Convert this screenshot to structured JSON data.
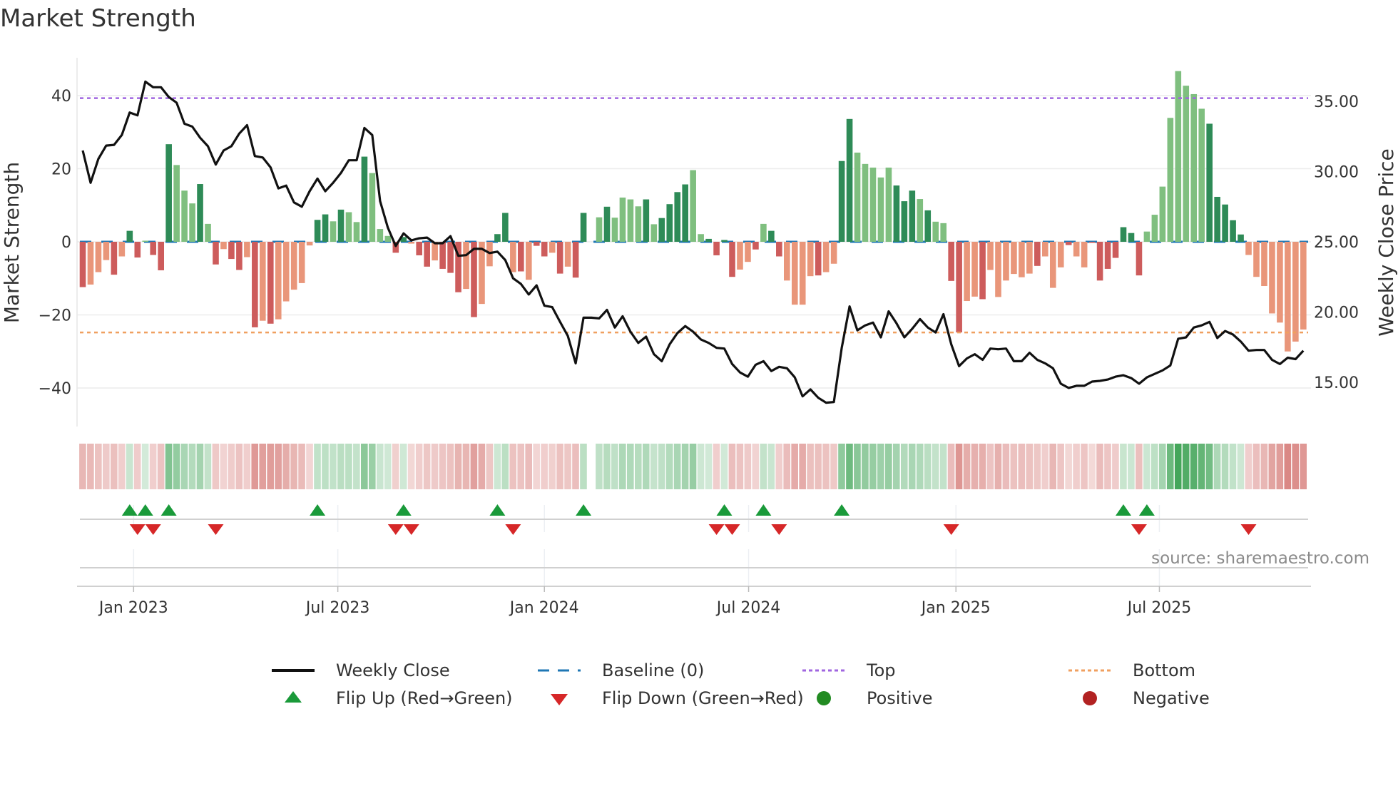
{
  "title": "Market Strength",
  "source": "source: sharemaestro.com",
  "colors": {
    "pos_strong": "#2e8b57",
    "pos_weak": "#7fbf7f",
    "neg_strong": "#cd5c5c",
    "neg_weak": "#e9967a",
    "close": "#111111",
    "baseline": "#1f77b4",
    "top": "#a066e0",
    "bottom": "#f0a060",
    "flip_up": "#1a9a3a",
    "flip_down": "#d62728",
    "positive": "#228b22",
    "negative": "#b22222"
  },
  "legend": [
    {
      "label": "Weekly Close",
      "icon": "solid-line"
    },
    {
      "label": "Baseline (0)",
      "icon": "dashed-line"
    },
    {
      "label": "Top",
      "icon": "dotted-line-purple"
    },
    {
      "label": "Bottom",
      "icon": "dotted-line-orange"
    },
    {
      "label": "Flip Up (Red→Green)",
      "icon": "triangle-up"
    },
    {
      "label": "Flip Down (Green→Red)",
      "icon": "triangle-down"
    },
    {
      "label": "Positive",
      "icon": "circle-green"
    },
    {
      "label": "Negative",
      "icon": "circle-red"
    }
  ],
  "chart_data": {
    "type": "bar",
    "title": "Market Strength",
    "ylabel": "Market Strength",
    "y2label": "Weekly Close Price",
    "ylim": [
      -52,
      50
    ],
    "y2lim": [
      12.4,
      37.4
    ],
    "yticks": [
      -40,
      -20,
      0,
      20,
      40
    ],
    "yticklabels": [
      "−40",
      "−20",
      "0",
      "20",
      "40"
    ],
    "y2ticks": [
      15,
      20,
      25,
      30,
      35
    ],
    "y2ticklabels": [
      "15.00",
      "20.00",
      "25.00",
      "30.00",
      "35.00"
    ],
    "xticks": [
      {
        "week": 6.5,
        "label": "Jan 2023"
      },
      {
        "week": 32.6,
        "label": "Jul 2023"
      },
      {
        "week": 59.0,
        "label": "Jan 2024"
      },
      {
        "week": 85.1,
        "label": "Jul 2024"
      },
      {
        "week": 111.6,
        "label": "Jan 2025"
      },
      {
        "week": 137.6,
        "label": "Jul 2025"
      }
    ],
    "top_level": 39.3,
    "bottom_level": -24.8,
    "baseline": 0,
    "grid": true,
    "legend_position": "bottom",
    "strength": [
      -12.4,
      -11.7,
      -8.3,
      -5,
      -9,
      -4,
      3,
      -4.3,
      0.3,
      -3.6,
      -7.8,
      26.7,
      21,
      14,
      10.5,
      15.8,
      4.9,
      -6.2,
      -2,
      -4.7,
      -7.7,
      -4.2,
      -23.4,
      -21.6,
      -22.4,
      -21.2,
      -16.3,
      -13.1,
      -11.3,
      -1,
      6,
      7.5,
      5.6,
      8.8,
      8.1,
      5.4,
      23.3,
      18.8,
      3.5,
      1.6,
      -3,
      1.3,
      -0.5,
      -3.7,
      -6.8,
      -5.1,
      -7.4,
      -8.5,
      -13.8,
      -12.9,
      -20.6,
      -17,
      -6.7,
      2.1,
      7.9,
      -8.3,
      -8.1,
      -10.4,
      -1.1,
      -4,
      -3,
      -8.7,
      -6.8,
      -9.8,
      7.9,
      0,
      6.7,
      9.6,
      6.6,
      12.1,
      11.6,
      9.7,
      11.6,
      4.8,
      6.5,
      10.3,
      13.6,
      15.7,
      19.6,
      2.1,
      0.8,
      -3.7,
      0.5,
      -9.6,
      -7.6,
      -5.5,
      -2.1,
      4.9,
      3,
      -4,
      -10.6,
      -17.2,
      -17.2,
      -9.4,
      -9.2,
      -8.3,
      -6,
      22.1,
      33.6,
      24.4,
      21.3,
      20.3,
      17.6,
      20.3,
      15.4,
      11.1,
      14,
      11.7,
      8.6,
      5.5,
      5.1,
      -10.7,
      -24.8,
      -16.2,
      -15,
      -15.7,
      -7.7,
      -15.1,
      -10.6,
      -8.8,
      -9.7,
      -8.7,
      -6.6,
      -4,
      -12.6,
      -7,
      -0.9,
      -4,
      -7,
      -0.3,
      -10.6,
      -7.4,
      -4.4,
      4,
      2.4,
      -9.2,
      2.8,
      7.4,
      15.1,
      33.9,
      46.7,
      42.7,
      40.4,
      36.4,
      32.3,
      12.3,
      10.2,
      5.9,
      2,
      -3.6,
      -9.6,
      -12.1,
      -19.6,
      -22.1,
      -30,
      -27.3,
      -24
    ],
    "strength_shade": "dllldlddlddd llldldld dldldlllll ddldlldlll ddlddldddl dllddldldd ldl d d-ldlllldl ddddllddd dlldlddlll ldllddlll lldddld llddlldlllllldlll dlldddddddlllllllldddddl l",
    "weekly_close": [
      31.5,
      29.2,
      30.9,
      31.85,
      31.9,
      32.6,
      34.2,
      34.0,
      36.4,
      36.0,
      36.0,
      35.3,
      34.9,
      33.4,
      33.2,
      32.4,
      31.8,
      30.5,
      31.5,
      31.8,
      32.7,
      33.3,
      31.1,
      31.0,
      30.3,
      28.8,
      29.0,
      27.8,
      27.5,
      28.6,
      29.5,
      28.6,
      29.2,
      29.9,
      30.8,
      30.8,
      33.1,
      32.6,
      27.9,
      26.0,
      24.7,
      25.6,
      25.1,
      25.25,
      25.3,
      24.9,
      24.9,
      25.4,
      24.0,
      24.05,
      24.5,
      24.5,
      24.2,
      24.3,
      23.7,
      22.4,
      22.0,
      21.25,
      21.9,
      20.45,
      20.35,
      19.3,
      18.3,
      16.35,
      19.6,
      19.6,
      19.55,
      20.15,
      18.9,
      19.7,
      18.6,
      17.8,
      18.25,
      17.0,
      16.5,
      17.7,
      18.5,
      19.0,
      18.6,
      18.05,
      17.8,
      17.45,
      17.4,
      16.3,
      15.7,
      15.4,
      16.25,
      16.5,
      15.8,
      16.1,
      16.0,
      15.35,
      14.0,
      14.5,
      13.9,
      13.55,
      13.6,
      17.45,
      20.4,
      18.7,
      19.05,
      19.25,
      18.2,
      20.05,
      19.2,
      18.2,
      18.8,
      19.5,
      18.9,
      18.55,
      19.85,
      17.7,
      16.15,
      16.7,
      17.0,
      16.6,
      17.4,
      17.35,
      17.4,
      16.5,
      16.5,
      17.1,
      16.6,
      16.35,
      16.0,
      14.9,
      14.6,
      14.75,
      14.75,
      15.05,
      15.1,
      15.2,
      15.4,
      15.5,
      15.3,
      14.9,
      15.35,
      15.6,
      15.85,
      16.2,
      18.1,
      18.2,
      18.9,
      19.05,
      19.3,
      18.15,
      18.65,
      18.4,
      17.9,
      17.25,
      17.3,
      17.3,
      16.6,
      16.3,
      16.75,
      16.65,
      17.25
    ],
    "flip_up_weeks": [
      6,
      8,
      11,
      30,
      41,
      53,
      64,
      82,
      87,
      97,
      133,
      136
    ],
    "flip_down_weeks": [
      7,
      9,
      17,
      40,
      42,
      55,
      81,
      83,
      89,
      111,
      135,
      149
    ]
  }
}
